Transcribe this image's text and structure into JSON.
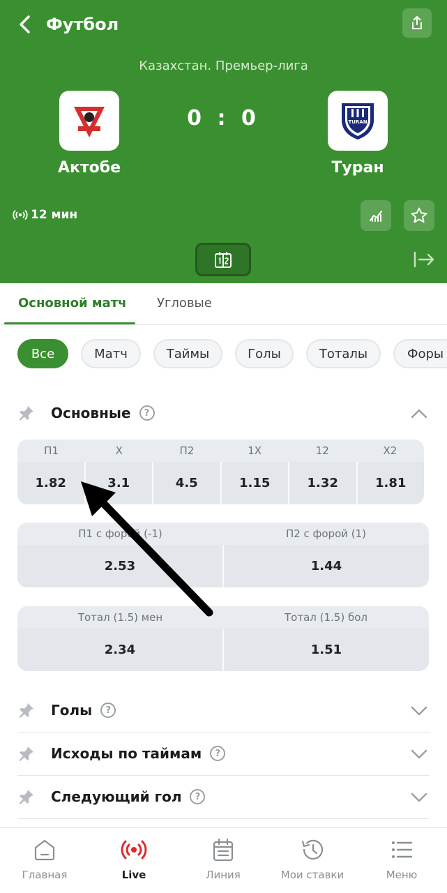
{
  "header": {
    "title": "Футбол",
    "league": "Казахстан. Премьер-лига",
    "home_team": "Актобе",
    "away_team": "Туран",
    "away_logo_text": "TURAN",
    "home_score": "0",
    "away_score": "0",
    "score_separator": ":",
    "live_time": "12 мин",
    "accent_color": "#3a9030"
  },
  "tabs": [
    {
      "label": "Основной матч",
      "active": true
    },
    {
      "label": "Угловые",
      "active": false
    }
  ],
  "filters": [
    {
      "label": "Все",
      "active": true
    },
    {
      "label": "Матч",
      "active": false
    },
    {
      "label": "Таймы",
      "active": false
    },
    {
      "label": "Голы",
      "active": false
    },
    {
      "label": "Тоталы",
      "active": false
    },
    {
      "label": "Форы",
      "active": false
    }
  ],
  "main_section": {
    "title": "Основные",
    "help": "?",
    "outcomes": {
      "headers": [
        "П1",
        "Х",
        "П2",
        "1Х",
        "12",
        "Х2"
      ],
      "values": [
        "1.82",
        "3.1",
        "4.5",
        "1.15",
        "1.32",
        "1.81"
      ]
    },
    "handicap": {
      "headers": [
        "П1 с форой (-1)",
        "П2 с форой (1)"
      ],
      "values": [
        "2.53",
        "1.44"
      ]
    },
    "total": {
      "headers": [
        "Тотал (1.5) мен",
        "Тотал (1.5) бол"
      ],
      "values": [
        "2.34",
        "1.51"
      ]
    }
  },
  "collapsed_sections": [
    {
      "title": "Голы",
      "help": "?"
    },
    {
      "title": "Исходы по таймам",
      "help": "?"
    },
    {
      "title": "Следующий гол",
      "help": "?"
    }
  ],
  "bottom_nav": [
    {
      "label": "Главная",
      "icon": "home-icon",
      "active": false
    },
    {
      "label": "Live",
      "icon": "live-broadcast-icon",
      "active": true
    },
    {
      "label": "Линия",
      "icon": "calendar-icon",
      "active": false
    },
    {
      "label": "Мои ставки",
      "icon": "history-icon",
      "active": false
    },
    {
      "label": "Меню",
      "icon": "menu-icon",
      "active": false
    }
  ]
}
